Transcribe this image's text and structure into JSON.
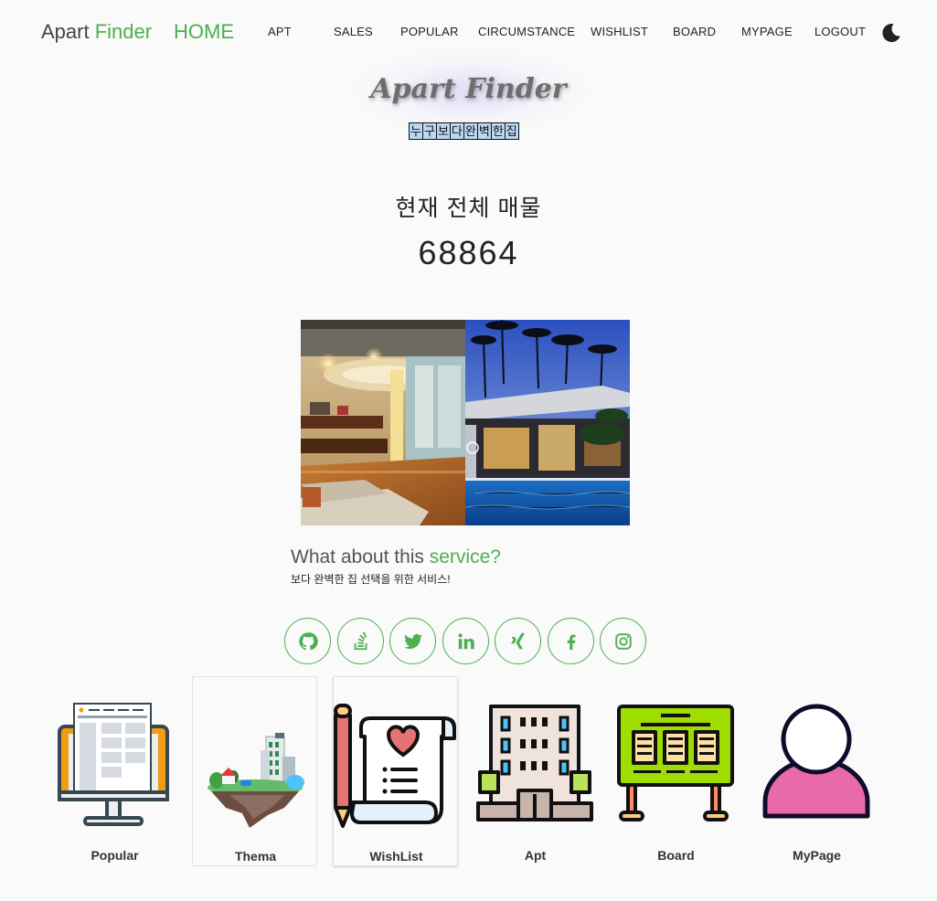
{
  "nav": {
    "brand_part1": "Apart ",
    "brand_part2": "Finder",
    "home": "HOME",
    "items": [
      "APT",
      "SALES",
      "POPULAR",
      "CIRCUMSTANCE",
      "WISHLIST",
      "BOARD",
      "MYPAGE",
      "LOGOUT"
    ],
    "theme_icon": "moon-icon"
  },
  "hero": {
    "title": "Apart Finder",
    "tagline_chars": [
      "누",
      "구",
      "보",
      "다",
      "완",
      "벽",
      "한",
      "집"
    ]
  },
  "stats": {
    "label": "현재 전체 매물",
    "value": "68864"
  },
  "service": {
    "title_part1": "What about this ",
    "title_part2": "service?",
    "subtitle": "보다 완벽한 집 선택을 위한 서비스!"
  },
  "social": [
    "github-icon",
    "stackoverflow-icon",
    "twitter-icon",
    "linkedin-icon",
    "xing-icon",
    "facebook-icon",
    "instagram-icon"
  ],
  "cards": [
    {
      "label": "Popular",
      "icon": "monitor-icon"
    },
    {
      "label": "Thema",
      "icon": "floating-island-icon"
    },
    {
      "label": "WishList",
      "icon": "wishlist-scroll-icon"
    },
    {
      "label": "Apt",
      "icon": "apartment-building-icon"
    },
    {
      "label": "Board",
      "icon": "bulletin-board-icon"
    },
    {
      "label": "MyPage",
      "icon": "user-profile-icon"
    }
  ],
  "colors": {
    "accent": "#4caf50",
    "background": "#fafafa"
  }
}
